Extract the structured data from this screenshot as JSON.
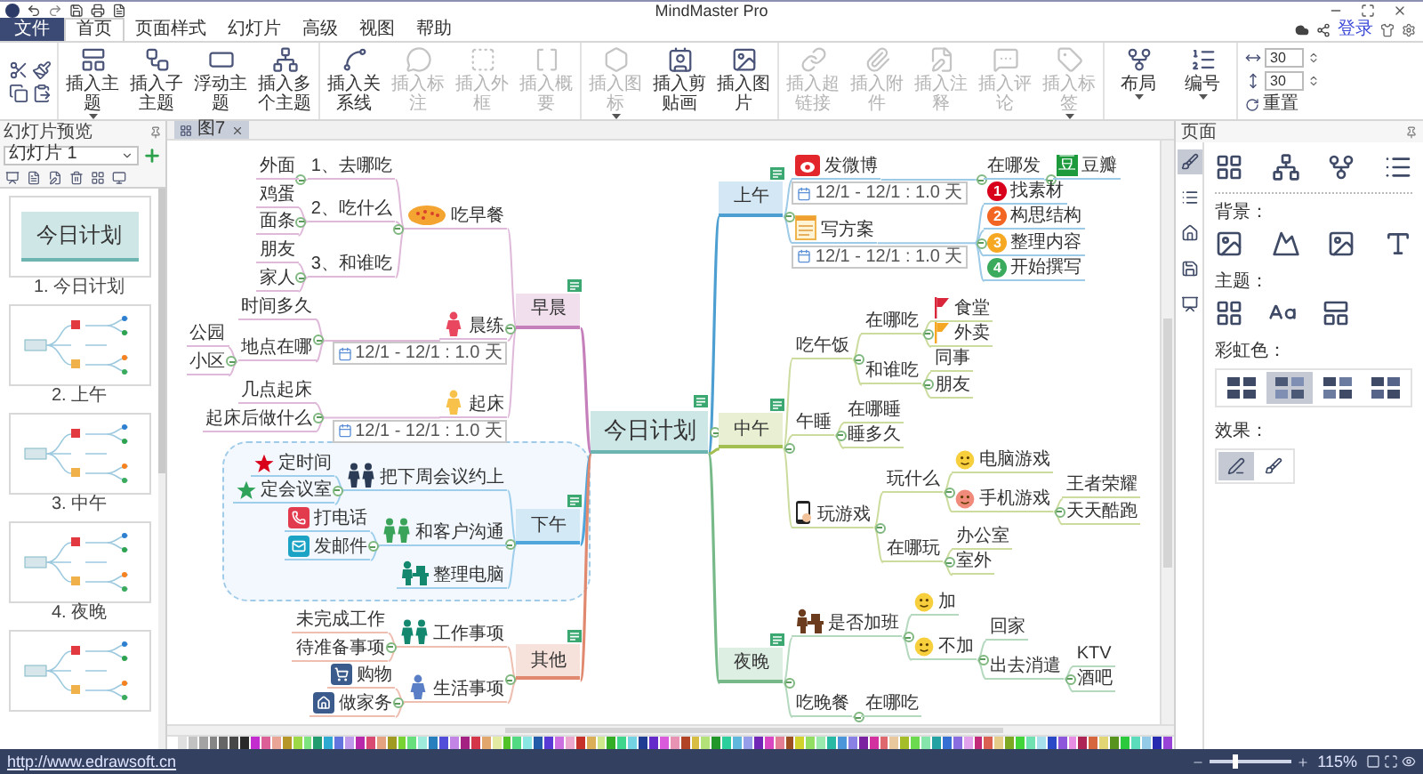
{
  "window": {
    "title": "MindMaster Pro"
  },
  "menu": {
    "file": "文件",
    "tabs": [
      {
        "label": "首页",
        "selected": true
      },
      {
        "label": "页面样式",
        "selected": false
      },
      {
        "label": "幻灯片",
        "selected": false
      },
      {
        "label": "高级",
        "selected": false
      },
      {
        "label": "视图",
        "selected": false
      },
      {
        "label": "帮助",
        "selected": false
      }
    ],
    "login": "登录"
  },
  "ribbon": [
    {
      "buttons": [
        {
          "label": "插入主题",
          "disabled": false,
          "dropdown": true
        },
        {
          "label": "插入子主题",
          "disabled": false,
          "dropdown": false
        },
        {
          "label": "浮动主题",
          "disabled": false,
          "dropdown": false
        },
        {
          "label": "插入多个主题",
          "disabled": false,
          "dropdown": false
        }
      ]
    },
    {
      "buttons": [
        {
          "label": "插入关系线",
          "disabled": false,
          "dropdown": false
        },
        {
          "label": "插入标注",
          "disabled": true,
          "dropdown": false
        },
        {
          "label": "插入外框",
          "disabled": true,
          "dropdown": false
        },
        {
          "label": "插入概要",
          "disabled": true,
          "dropdown": false
        }
      ]
    },
    {
      "buttons": [
        {
          "label": "插入图标",
          "disabled": true,
          "dropdown": true
        },
        {
          "label": "插入剪贴画",
          "disabled": false,
          "dropdown": false
        },
        {
          "label": "插入图片",
          "disabled": false,
          "dropdown": false
        }
      ]
    },
    {
      "buttons": [
        {
          "label": "插入超链接",
          "disabled": true,
          "dropdown": false
        },
        {
          "label": "插入附件",
          "disabled": true,
          "dropdown": false
        },
        {
          "label": "插入注释",
          "disabled": true,
          "dropdown": false
        },
        {
          "label": "插入评论",
          "disabled": true,
          "dropdown": false
        },
        {
          "label": "插入标签",
          "disabled": true,
          "dropdown": true
        }
      ]
    },
    {
      "buttons": [
        {
          "label": "布局",
          "disabled": false,
          "dropdown": true
        },
        {
          "label": "编号",
          "disabled": false,
          "dropdown": true
        }
      ]
    }
  ],
  "spacing": [
    "30",
    "30"
  ],
  "reset": "重置",
  "slides_panel": {
    "title": "幻灯片预览",
    "selector": "幻灯片 1",
    "slides": [
      {
        "kind": "title",
        "title": "今日计划",
        "caption": "1. 今日计划"
      },
      {
        "kind": "map",
        "caption": "2. 上午"
      },
      {
        "kind": "map",
        "caption": "3. 中午"
      },
      {
        "kind": "map",
        "caption": "4. 夜晚"
      },
      {
        "kind": "map"
      }
    ]
  },
  "document_tab": {
    "label": "图7"
  },
  "mind_map": {
    "central": {
      "label": "今日计划"
    },
    "left": [
      {
        "label": "早晨",
        "color": "#c57fba",
        "children": [
          {
            "label": "吃早餐",
            "children": [
              {
                "label": "1、去哪吃",
                "children": [
                  {
                    "label": "外面"
                  }
                ]
              },
              {
                "label": "2、吃什么",
                "children": [
                  {
                    "label": "鸡蛋"
                  },
                  {
                    "label": "面条"
                  }
                ]
              },
              {
                "label": "3、和谁吃",
                "children": [
                  {
                    "label": "朋友"
                  },
                  {
                    "label": "家人"
                  }
                ]
              }
            ]
          },
          {
            "label": "晨练",
            "task": "12/1 - 12/1 : 1.0 天",
            "children": [
              {
                "label": "时间多久"
              },
              {
                "label": "地点在哪",
                "children": [
                  {
                    "label": "公园"
                  },
                  {
                    "label": "小区"
                  }
                ]
              }
            ]
          },
          {
            "label": "起床",
            "task": "12/1 - 12/1 : 1.0 天",
            "children": [
              {
                "label": "几点起床"
              },
              {
                "label": "起床后做什么"
              }
            ]
          }
        ]
      },
      {
        "label": "下午",
        "color": "#4ea6dc",
        "boundary": true,
        "children": [
          {
            "label": "把下周会议约上",
            "children": [
              {
                "label": "定时间",
                "color": "#d9001b"
              },
              {
                "label": "定会议室",
                "color": "#2fa35a"
              }
            ]
          },
          {
            "label": "和客户沟通",
            "children": [
              {
                "label": "打电话"
              },
              {
                "label": "发邮件"
              }
            ]
          },
          {
            "label": "整理电脑"
          }
        ]
      },
      {
        "label": "其他",
        "color": "#e0896f",
        "children": [
          {
            "label": "工作事项",
            "children": [
              {
                "label": "未完成工作"
              },
              {
                "label": "待准备事项"
              }
            ]
          },
          {
            "label": "生活事项",
            "children": [
              {
                "label": "购物"
              },
              {
                "label": "做家务"
              }
            ]
          }
        ]
      }
    ],
    "right": [
      {
        "label": "上午",
        "color": "#4d9fd2",
        "children": [
          {
            "label": "发微博",
            "task": "12/1 - 12/1 : 1.0 天",
            "children": [
              {
                "label": "在哪发",
                "children": [
                  {
                    "label": "豆瓣",
                    "logo": "豆"
                  }
                ]
              }
            ]
          },
          {
            "label": "写方案",
            "task": "12/1 - 12/1 : 1.0 天",
            "children": [
              {
                "label": "找素材",
                "marker": "1",
                "color": "#d9001b"
              },
              {
                "label": "构思结构",
                "marker": "2",
                "color": "#f26522"
              },
              {
                "label": "整理内容",
                "marker": "3",
                "color": "#f7a823"
              },
              {
                "label": "开始撰写",
                "marker": "4",
                "color": "#3aaa5c"
              }
            ]
          }
        ]
      },
      {
        "label": "中午",
        "color": "#a3bf4f",
        "children": [
          {
            "label": "吃午饭",
            "children": [
              {
                "label": "在哪吃",
                "children": [
                  {
                    "label": "食堂",
                    "color": "#d9263b"
                  },
                  {
                    "label": "外卖",
                    "color": "#f5a623"
                  }
                ]
              },
              {
                "label": "和谁吃",
                "children": [
                  {
                    "label": "同事"
                  },
                  {
                    "label": "朋友"
                  }
                ]
              }
            ]
          },
          {
            "label": "午睡",
            "children": [
              {
                "label": "在哪睡"
              },
              {
                "label": "睡多久"
              }
            ]
          },
          {
            "label": "玩游戏",
            "children": [
              {
                "label": "玩什么",
                "children": [
                  {
                    "label": "电脑游戏"
                  },
                  {
                    "label": "手机游戏",
                    "children": [
                      {
                        "label": "王者荣耀"
                      },
                      {
                        "label": "天天酷跑"
                      }
                    ]
                  }
                ]
              },
              {
                "label": "在哪玩",
                "children": [
                  {
                    "label": "办公室"
                  },
                  {
                    "label": "室外"
                  }
                ]
              }
            ]
          }
        ]
      },
      {
        "label": "夜晚",
        "color": "#78b98a",
        "children": [
          {
            "label": "是否加班",
            "children": [
              {
                "label": "加"
              },
              {
                "label": "不加",
                "children": [
                  {
                    "label": "回家"
                  },
                  {
                    "label": "出去消遣",
                    "children": [
                      {
                        "label": "KTV"
                      },
                      {
                        "label": "酒吧"
                      }
                    ]
                  }
                ]
              }
            ]
          },
          {
            "label": "吃晚餐",
            "children": [
              {
                "label": "在哪吃"
              }
            ]
          }
        ]
      }
    ]
  },
  "page_panel": {
    "title": "页面",
    "tools": [
      {
        "selected": true
      },
      {
        "selected": false
      },
      {
        "selected": false
      },
      {
        "selected": false
      },
      {
        "selected": false
      }
    ],
    "background_label": "背景：",
    "theme_label": "主题：",
    "rainbow_label": "彩虹色：",
    "rainbow": [
      {
        "selected": false
      },
      {
        "selected": true
      },
      {
        "selected": false
      },
      {
        "selected": false
      }
    ],
    "effects_label": "效果：",
    "effects": [
      {
        "selected": true
      },
      {
        "selected": false
      }
    ]
  },
  "status_bar": {
    "url": "http://www.edrawsoft.cn",
    "zoom": {
      "level": 0.33,
      "reading": "115%"
    }
  }
}
